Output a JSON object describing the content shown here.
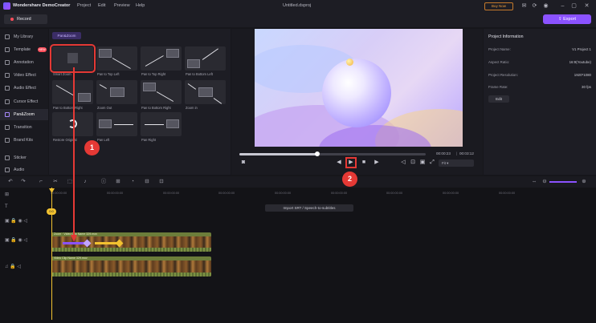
{
  "app": {
    "name": "Wondershare DemoCreator",
    "file_title": "Untitled.dsproj"
  },
  "menu": [
    "Project",
    "Edit",
    "Preview",
    "Help"
  ],
  "topbar": {
    "buy_now": "Buy Now"
  },
  "toolbar_top": {
    "record": "Record",
    "export": "Export"
  },
  "sidebar": {
    "items": [
      {
        "label": "My Library",
        "icon": "library-icon"
      },
      {
        "label": "Template",
        "icon": "template-icon",
        "badge": "NEW"
      },
      {
        "label": "Annotation",
        "icon": "annotation-icon"
      },
      {
        "label": "Video Effect",
        "icon": "video-effect-icon"
      },
      {
        "label": "Audio Effect",
        "icon": "audio-effect-icon"
      },
      {
        "label": "Cursor Effect",
        "icon": "cursor-effect-icon"
      },
      {
        "label": "Pan&Zoom",
        "icon": "pan-zoom-icon",
        "active": true
      },
      {
        "label": "Transition",
        "icon": "transition-icon"
      },
      {
        "label": "Brand Kits",
        "icon": "brand-kits-icon"
      },
      {
        "label": "Sticker",
        "icon": "sticker-icon"
      },
      {
        "label": "Audio",
        "icon": "audio-icon"
      }
    ]
  },
  "effects": {
    "category_tag": "Pan&Zoom",
    "tiles": [
      {
        "label": "Smart Zoom"
      },
      {
        "label": "Pan to Top Left"
      },
      {
        "label": "Pan to Top Right"
      },
      {
        "label": "Pan to Bottom Left"
      },
      {
        "label": "Pan to Bottom Right"
      },
      {
        "label": "Zoom Out"
      },
      {
        "label": "Pan to Bottom Right"
      },
      {
        "label": "Zoom in"
      },
      {
        "label": "Restore Original"
      },
      {
        "label": "Pan Left"
      },
      {
        "label": "Pan Right"
      }
    ]
  },
  "player": {
    "current_time": "00:00:23",
    "total_time": "00:03:12",
    "fit": "Fit",
    "progress": 0.42
  },
  "project_info": {
    "title": "Project Information",
    "rows": [
      {
        "key": "Project Name:",
        "value": "V1 Project 1"
      },
      {
        "key": "Aspect Ratio:",
        "value": "16:9(Youtube)"
      },
      {
        "key": "Project Resolution:",
        "value": "1920*1080"
      },
      {
        "key": "Frame Rate:",
        "value": "30 fps"
      }
    ],
    "edit": "Edit"
  },
  "timeline": {
    "ruler": [
      "00:00:00:00",
      "00:00:00:00",
      "00:00:00:00",
      "00:00:00:00",
      "00:00:00:00",
      "00:00:00:00",
      "00:00:00:00",
      "00:00:00:00",
      "00:00:00:00"
    ],
    "import_srt": "Import SRT / Speech-to-subtitles",
    "clip_video": "Video Clip Name 329.mov",
    "clip_video_tag": "Zoom",
    "clip_audio": "Video Clip Name 329.mov",
    "playhead_label": "0:0"
  },
  "annotations": {
    "badge1": "1",
    "badge2": "2"
  },
  "colors": {
    "accent": "#8b52ff",
    "highlight": "#e53935",
    "playhead": "#f2c230"
  }
}
